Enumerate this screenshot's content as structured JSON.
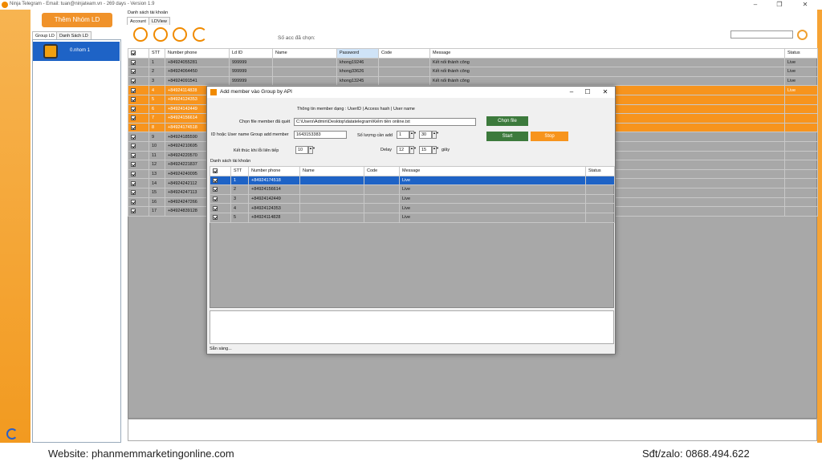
{
  "window": {
    "title": "Ninja Telegram - Email: tuan@ninjateam.vn - 269 days - Version 1.9"
  },
  "left": {
    "add_group_label": "Thêm Nhóm LD",
    "tabs": [
      "Group LD",
      "Danh Sách LD"
    ],
    "group_item": "0.nhom 1"
  },
  "main": {
    "section_label": "Danh sách tài khoản",
    "tabs": [
      "Account",
      "LDView"
    ],
    "selected_count_label": "Số acc đã chọn:"
  },
  "grid": {
    "columns": [
      "STT",
      "Number phone",
      "Ld ID",
      "Name",
      "Password",
      "Code",
      "Message",
      "Status"
    ],
    "rows": [
      [
        "1",
        "+84924055281",
        "999999",
        "",
        "khong19246",
        "",
        "Kết nối thành công",
        "Live"
      ],
      [
        "2",
        "+84924064450",
        "999999",
        "",
        "khong33626",
        "",
        "Kết nối thành công",
        "Live"
      ],
      [
        "3",
        "+84924091541",
        "999999",
        "",
        "khong13245",
        "",
        "Kết nối thành công",
        "Live"
      ],
      [
        "4",
        "+84924114828",
        "",
        "",
        "",
        "",
        "",
        "Live"
      ],
      [
        "5",
        "+84924124353",
        "",
        "",
        "",
        "",
        "",
        ""
      ],
      [
        "6",
        "+84924142449",
        "",
        "",
        "",
        "",
        "",
        ""
      ],
      [
        "7",
        "+84924156614",
        "",
        "",
        "",
        "",
        "",
        ""
      ],
      [
        "8",
        "+84924174518",
        "",
        "",
        "",
        "",
        "",
        ""
      ],
      [
        "9",
        "+84924185590",
        "",
        "",
        "",
        "",
        "",
        ""
      ],
      [
        "10",
        "+84924210695",
        "",
        "",
        "",
        "",
        "",
        ""
      ],
      [
        "11",
        "+84924220570",
        "",
        "",
        "",
        "",
        "",
        ""
      ],
      [
        "12",
        "+84924221837",
        "",
        "",
        "",
        "",
        "",
        ""
      ],
      [
        "13",
        "+84924240095",
        "",
        "",
        "",
        "",
        "",
        ""
      ],
      [
        "14",
        "+84924242112",
        "",
        "",
        "",
        "",
        "",
        ""
      ],
      [
        "15",
        "+84924247113",
        "",
        "",
        "",
        "",
        "",
        ""
      ],
      [
        "16",
        "+84924247266",
        "",
        "",
        "",
        "",
        "",
        ""
      ],
      [
        "17",
        "+84924839128",
        "",
        "",
        "",
        "",
        "",
        ""
      ]
    ],
    "selected_rows": [
      4,
      5,
      6,
      7,
      8
    ]
  },
  "dialog": {
    "title": "Add member vào Group by API",
    "info": "Thông tin member dạng : UserID | Access hash | User name",
    "file_label": "Chọn file member đã quét",
    "file_path": "C:\\Users\\Admin\\Desktop\\datatelegram\\Kiếm tiền online.txt",
    "choose_file": "Chọn file",
    "id_label": "ID hoặc User name Group add member",
    "id_value": "1643153383",
    "qty_label": "Số lượng cần add",
    "qty_from": "1",
    "qty_to": "30",
    "err_label": "Kết thúc khi lỗi liên tiếp",
    "err_value": "10",
    "delay_label": "Delay",
    "delay_from": "12",
    "delay_to": "15",
    "delay_unit": "giây",
    "start": "Start",
    "stop": "Stop",
    "list_label": "Danh sách tài khoản",
    "status": "Sẵn sàng...",
    "columns": [
      "STT",
      "Number phone",
      "Name",
      "Code",
      "Message",
      "Status"
    ],
    "rows": [
      [
        "1",
        "+84924174518",
        "",
        "",
        "Live",
        ""
      ],
      [
        "2",
        "+84924156614",
        "",
        "",
        "Live",
        ""
      ],
      [
        "3",
        "+84924142449",
        "",
        "",
        "Live",
        ""
      ],
      [
        "4",
        "+84924124353",
        "",
        "",
        "Live",
        ""
      ],
      [
        "5",
        "+84924114828",
        "",
        "",
        "Live",
        ""
      ]
    ]
  },
  "footer": {
    "website": "Website: phanmemmarketingonline.com",
    "phone": "Sđt/zalo: 0868.494.622"
  },
  "colors": {
    "accent": "#f7941d",
    "select": "#1e63c6"
  }
}
